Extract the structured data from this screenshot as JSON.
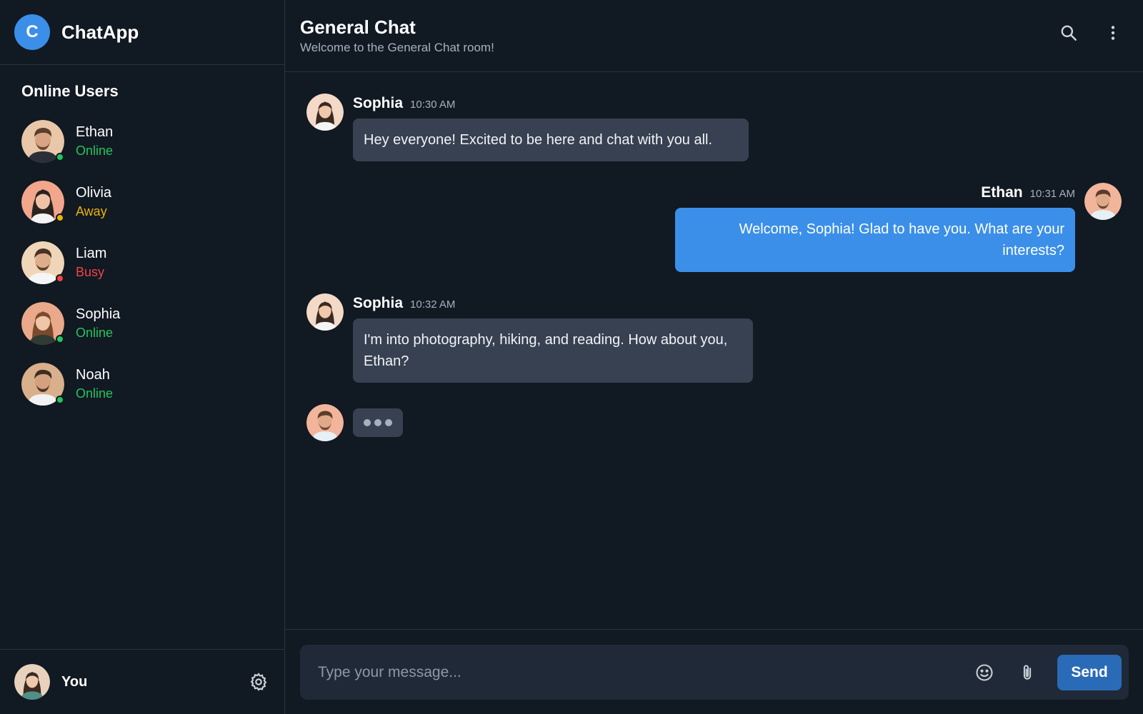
{
  "app": {
    "logo_letter": "C",
    "name": "ChatApp"
  },
  "sidebar": {
    "online_title": "Online Users",
    "users": [
      {
        "name": "Ethan",
        "status": "Online",
        "status_color": "#22c55e"
      },
      {
        "name": "Olivia",
        "status": "Away",
        "status_color": "#eab308"
      },
      {
        "name": "Liam",
        "status": "Busy",
        "status_color": "#ef4444"
      },
      {
        "name": "Sophia",
        "status": "Online",
        "status_color": "#22c55e"
      },
      {
        "name": "Noah",
        "status": "Online",
        "status_color": "#22c55e"
      }
    ],
    "footer": {
      "name": "You"
    }
  },
  "chat": {
    "title": "General Chat",
    "subtitle": "Welcome to the General Chat room!",
    "messages": [
      {
        "author": "Sophia",
        "time": "10:30 AM",
        "text": "Hey everyone! Excited to be here and chat with you all.",
        "mine": false
      },
      {
        "author": "Ethan",
        "time": "10:31 AM",
        "text": "Welcome, Sophia! Glad to have you. What are your interests?",
        "mine": true
      },
      {
        "author": "Sophia",
        "time": "10:32 AM",
        "text": "I'm into photography, hiking, and reading. How about you, Ethan?",
        "mine": false
      }
    ],
    "typing_user": "Ethan"
  },
  "composer": {
    "placeholder": "Type your message...",
    "send_label": "Send"
  },
  "colors": {
    "accent": "#3b8fe8",
    "send": "#2a6bb8",
    "bubble": "#374151",
    "background": "#111922"
  }
}
